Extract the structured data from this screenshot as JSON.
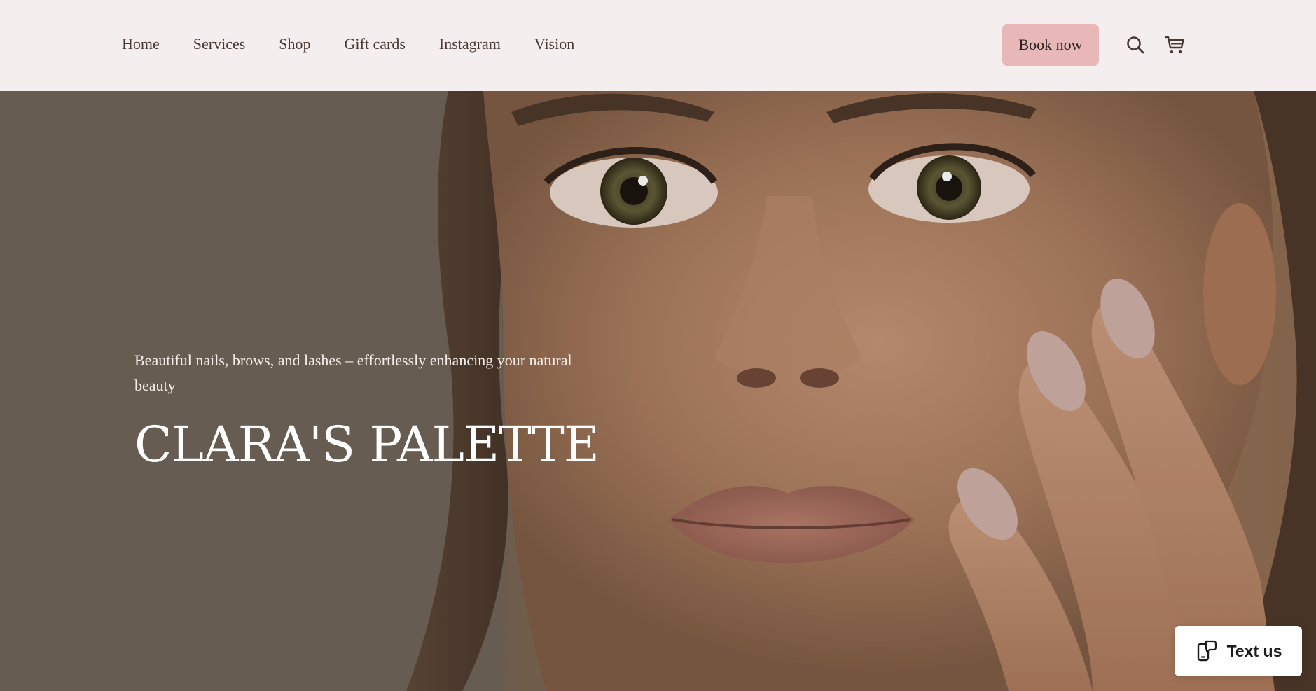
{
  "header": {
    "nav": [
      {
        "label": "Home"
      },
      {
        "label": "Services"
      },
      {
        "label": "Shop"
      },
      {
        "label": "Gift cards"
      },
      {
        "label": "Instagram"
      },
      {
        "label": "Vision"
      }
    ],
    "book_label": "Book now",
    "search_icon": "search-icon",
    "cart_icon": "cart-icon"
  },
  "hero": {
    "tagline": "Beautiful nails, brows, and lashes – effortlessly enhancing your natural beauty",
    "title": "CLARA'S PALETTE",
    "image": "close-up portrait of a woman with manicured nude nails touching her cheek"
  },
  "widget": {
    "label": "Text us",
    "icon": "message-phone-icon"
  },
  "colors": {
    "header_bg": "#f5eeee",
    "button_bg": "#e8b7b8",
    "nav_text": "#4a3a36",
    "hero_bg": "#6b6156"
  }
}
